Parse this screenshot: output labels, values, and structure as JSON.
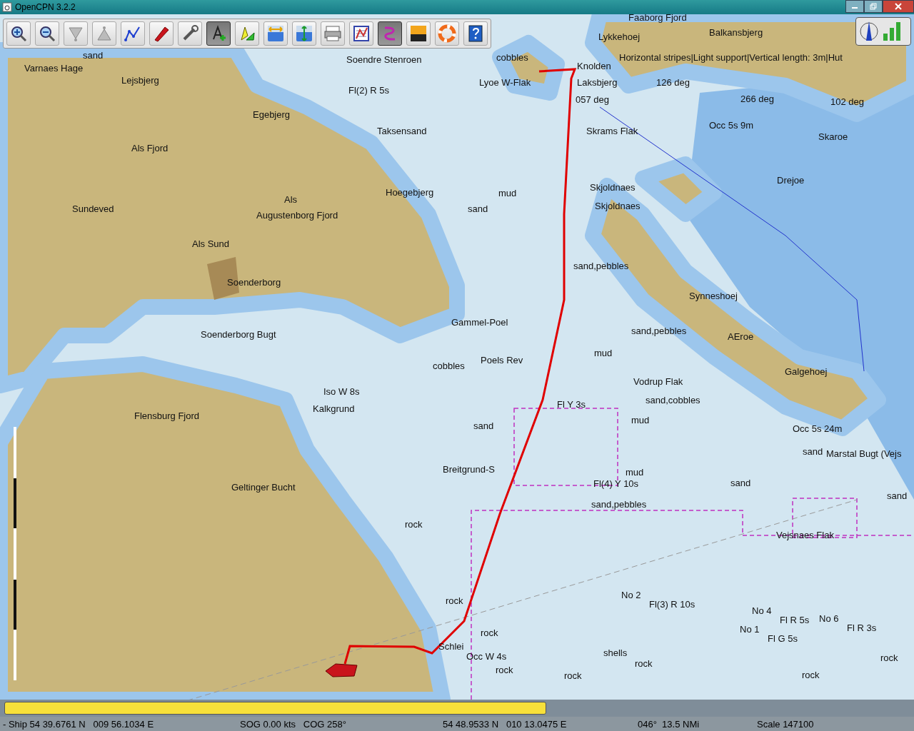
{
  "window": {
    "title": "OpenCPN 3.2.2"
  },
  "toolbar": [
    {
      "kind": "zoom-in",
      "selected": false
    },
    {
      "kind": "zoom-out",
      "selected": false
    },
    {
      "kind": "scale-down",
      "selected": false
    },
    {
      "kind": "scale-up",
      "selected": false
    },
    {
      "kind": "route",
      "selected": false
    },
    {
      "kind": "ship",
      "selected": false
    },
    {
      "kind": "tools",
      "selected": false
    },
    {
      "kind": "text",
      "selected": true
    },
    {
      "kind": "marks",
      "selected": false
    },
    {
      "kind": "tide",
      "selected": false
    },
    {
      "kind": "current",
      "selected": false
    },
    {
      "kind": "print",
      "selected": false
    },
    {
      "kind": "route-manager",
      "selected": false
    },
    {
      "kind": "track",
      "selected": true
    },
    {
      "kind": "color-scheme",
      "selected": false
    },
    {
      "kind": "lifebuoy",
      "selected": false
    },
    {
      "kind": "help",
      "selected": false
    }
  ],
  "chart_labels": [
    "Faaborg Fjord",
    "Lykkehoej",
    "Balkansbjerg",
    "sand",
    "Varnaes Hage",
    "Soendre Stenroen",
    "cobbles",
    "Knolden",
    "Horizontal stripes|Light support|Vertical length: 3m|Hut",
    "Lejsbjerg",
    "Lyoe W-Flak",
    "Laksbjerg",
    "126 deg",
    "Fl(2) R 5s",
    "057 deg",
    "266 deg",
    "102 deg",
    "Egebjerg",
    "Occ 5s 9m",
    "Taksensand",
    "Skrams Flak",
    "Skaroe",
    "Als Fjord",
    "Drejoe",
    "mud",
    "Skjoldnaes",
    "Hoegebjerg",
    "Als",
    "Sundeved",
    "sand",
    "Skjoldnaes",
    "Augustenborg Fjord",
    "Als Sund",
    "sand,pebbles",
    "Soenderborg",
    "Synneshoej",
    "Gammel-Poel",
    "Soenderborg Bugt",
    "sand,pebbles",
    "AEroe",
    "mud",
    "cobbles",
    "Poels Rev",
    "Galgehoej",
    "Vodrup Flak",
    "Iso W 8s",
    "sand,cobbles",
    "Fl Y 3s",
    "Kalkgrund",
    "Flensburg Fjord",
    "mud",
    "sand",
    "Occ 5s 24m",
    "sand",
    "Marstal Bugt (Vejs",
    "Breitgrund-S",
    "mud",
    "Fl(4) Y 10s",
    "sand",
    "Geltinger Bucht",
    "sand",
    "sand,pebbles",
    "rock",
    "Vejsnaes Flak",
    "rock",
    "No 2",
    "Fl(3) R 10s",
    "No 4",
    "Fl R 5s",
    "No 6",
    "Fl R 3s",
    "No 1",
    "Fl G 5s",
    "rock",
    "Schlei",
    "Occ W 4s",
    "shells",
    "rock",
    "rock",
    "rock",
    "rock",
    "rock"
  ],
  "status_bar": [
    "- Ship 54 39.6761 N   009 56.1034 E",
    "SOG 0.00 kts   COG 258°",
    "54 48.9533 N   010 13.0475 E",
    "046°  13.5 NMi",
    "Scale 147100"
  ]
}
